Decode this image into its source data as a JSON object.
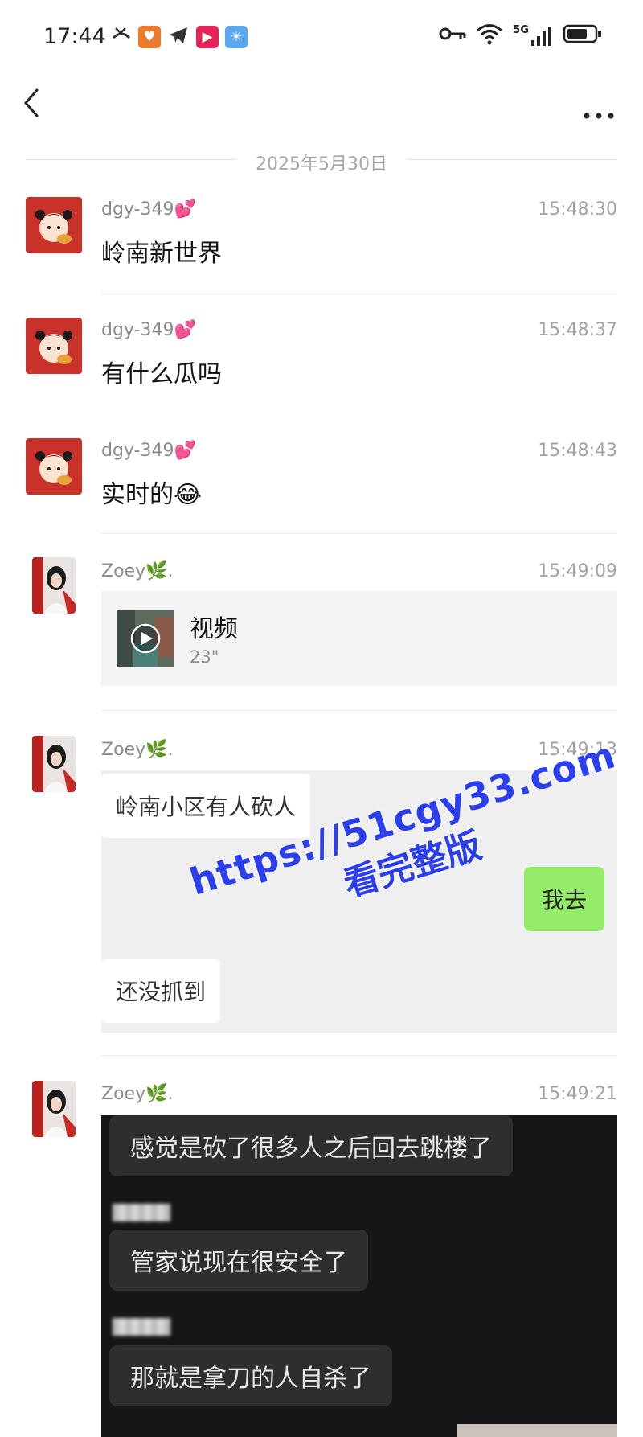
{
  "status_bar": {
    "time": "17:44",
    "network": "5G",
    "notification_icons": [
      "missed-call-icon",
      "shield-app-icon",
      "telegram-icon",
      "video-app-icon",
      "weather-app-icon"
    ]
  },
  "date_separator": "2025年5月30日",
  "messages": [
    {
      "sender": "dgy-349💕",
      "time": "15:48:30",
      "text": "岭南新世界"
    },
    {
      "sender": "dgy-349💕",
      "time": "15:48:37",
      "text": "有什么瓜吗"
    },
    {
      "sender": "dgy-349💕",
      "time": "15:48:43",
      "text": "实时的😂"
    },
    {
      "sender": "Zoey🌿.",
      "time": "15:49:09",
      "video": {
        "title": "视频",
        "duration": "23\""
      }
    },
    {
      "sender": "Zoey🌿.",
      "time": "15:49:13",
      "screenshot": {
        "bubble_1": "岭南小区有人砍人",
        "bubble_reply": "我去",
        "bubble_2": "还没抓到"
      }
    },
    {
      "sender": "Zoey🌿.",
      "time": "15:49:21",
      "screenshot": {
        "bubble_1": "感觉是砍了很多人之后回去跳楼了",
        "bubble_2": "管家说现在很安全了",
        "bubble_3": "那就是拿刀的人自杀了"
      }
    }
  ],
  "watermark": {
    "line1": "https://51cgy33.com",
    "line2": "看完整版",
    "color": "#2b3ff0"
  },
  "colors": {
    "accent_green": "#95ec69",
    "avatar_red": "#c9312b"
  }
}
